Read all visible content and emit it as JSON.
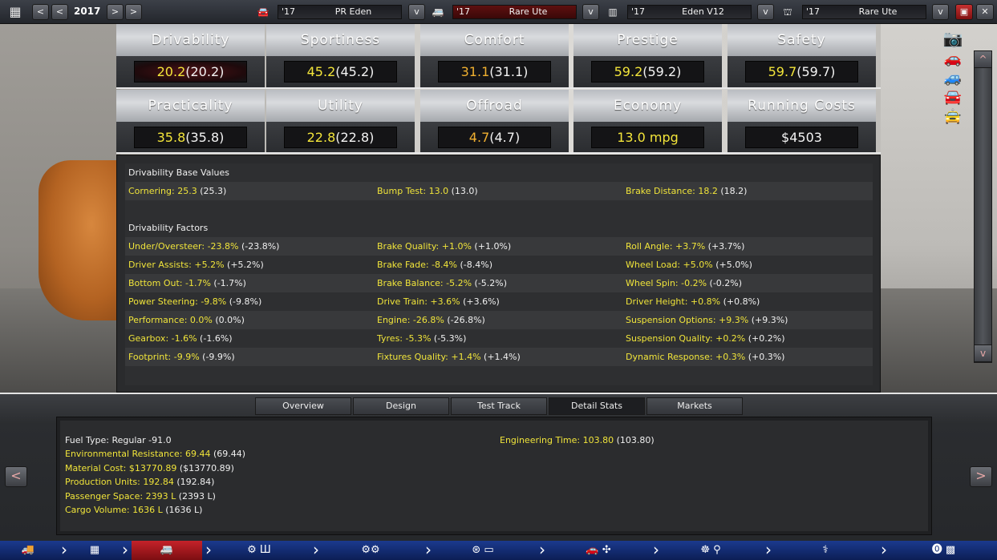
{
  "topbar": {
    "year": "2017",
    "prev_fast": "<",
    "prev": "<",
    "next": ">",
    "next_fast": ">",
    "models": [
      {
        "year": "'17",
        "name": "PR Eden"
      },
      {
        "year": "'17",
        "name": "Rare Ute"
      },
      {
        "year": "'17",
        "name": "Eden V12"
      },
      {
        "year": "'17",
        "name": "Rare Ute"
      }
    ],
    "dropdown": "v"
  },
  "tiles": [
    {
      "label": "Drivability",
      "value": "20.2",
      "paren": "(20.2)"
    },
    {
      "label": "Sportiness",
      "value": "45.2",
      "paren": "(45.2)"
    },
    {
      "label": "Comfort",
      "value": "31.1",
      "paren": "(31.1)"
    },
    {
      "label": "Prestige",
      "value": "59.2",
      "paren": "(59.2)"
    },
    {
      "label": "Safety",
      "value": "59.7",
      "paren": "(59.7)"
    },
    {
      "label": "Practicality",
      "value": "35.8",
      "paren": "(35.8)"
    },
    {
      "label": "Utility",
      "value": "22.8",
      "paren": "(22.8)"
    },
    {
      "label": "Offroad",
      "value": "4.7",
      "paren": "(4.7)"
    },
    {
      "label": "Economy",
      "value": "13.0 mpg",
      "paren": ""
    },
    {
      "label": "Running Costs",
      "value": "$4503",
      "paren": ""
    }
  ],
  "detail": {
    "base_title": "Drivability Base Values",
    "base": [
      {
        "k": "Cornering: 25.3",
        "v": " (25.3)"
      },
      {
        "k": "Bump Test: 13.0",
        "v": " (13.0)"
      },
      {
        "k": "Brake Distance: 18.2",
        "v": " (18.2)"
      }
    ],
    "factors_title": "Drivability Factors",
    "factors": [
      [
        {
          "k": "Under/Oversteer: -23.8%",
          "v": " (-23.8%)"
        },
        {
          "k": "Brake Quality: +1.0%",
          "v": " (+1.0%)"
        },
        {
          "k": "Roll Angle: +3.7%",
          "v": " (+3.7%)"
        }
      ],
      [
        {
          "k": "Driver Assists: +5.2%",
          "v": " (+5.2%)"
        },
        {
          "k": "Brake Fade: -8.4%",
          "v": " (-8.4%)"
        },
        {
          "k": "Wheel Load: +5.0%",
          "v": " (+5.0%)"
        }
      ],
      [
        {
          "k": "Bottom Out: -1.7%",
          "v": " (-1.7%)"
        },
        {
          "k": "Brake Balance: -5.2%",
          "v": " (-5.2%)"
        },
        {
          "k": "Wheel Spin: -0.2%",
          "v": " (-0.2%)"
        }
      ],
      [
        {
          "k": "Power Steering: -9.8%",
          "v": " (-9.8%)"
        },
        {
          "k": "Drive Train: +3.6%",
          "v": " (+3.6%)"
        },
        {
          "k": "Driver Height: +0.8%",
          "v": " (+0.8%)"
        }
      ],
      [
        {
          "k": "Performance: 0.0%",
          "v": " (0.0%)"
        },
        {
          "k": "Engine: -26.8%",
          "v": " (-26.8%)"
        },
        {
          "k": "Suspension Options: +9.3%",
          "v": " (+9.3%)"
        }
      ],
      [
        {
          "k": "Gearbox: -1.6%",
          "v": " (-1.6%)"
        },
        {
          "k": "Tyres: -5.3%",
          "v": " (-5.3%)"
        },
        {
          "k": "Suspension Quality: +0.2%",
          "v": " (+0.2%)"
        }
      ],
      [
        {
          "k": "Footprint: -9.9%",
          "v": " (-9.9%)"
        },
        {
          "k": "Fixtures Quality: +1.4%",
          "v": " (+1.4%)"
        },
        {
          "k": "Dynamic Response: +0.3%",
          "v": " (+0.3%)"
        }
      ]
    ]
  },
  "tabs": [
    "Overview",
    "Design",
    "Test Track",
    "Detail Stats",
    "Markets"
  ],
  "lower": {
    "fuel": "Fuel Type: Regular -91.0",
    "engineering": {
      "k": "Engineering Time: 103.80",
      "v": " (103.80)"
    },
    "rows": [
      {
        "k": "Environmental Resistance: 69.44",
        "v": " (69.44)"
      },
      {
        "k": "Material Cost: $13770.89",
        "v": " ($13770.89)"
      },
      {
        "k": "Production Units: 192.84",
        "v": " (192.84)"
      },
      {
        "k": "Passenger Space: 2393 L",
        "v": " (2393 L)"
      },
      {
        "k": "Cargo Volume: 1636 L",
        "v": " (1636 L)"
      }
    ],
    "left_arrow": "<",
    "right_arrow": ">"
  },
  "scroll": {
    "up": "^",
    "down": "v"
  },
  "colors": {
    "accent_yellow": "#f0e43a",
    "active_red": "#c4222a",
    "nav_blue": "#1b3a8e"
  }
}
